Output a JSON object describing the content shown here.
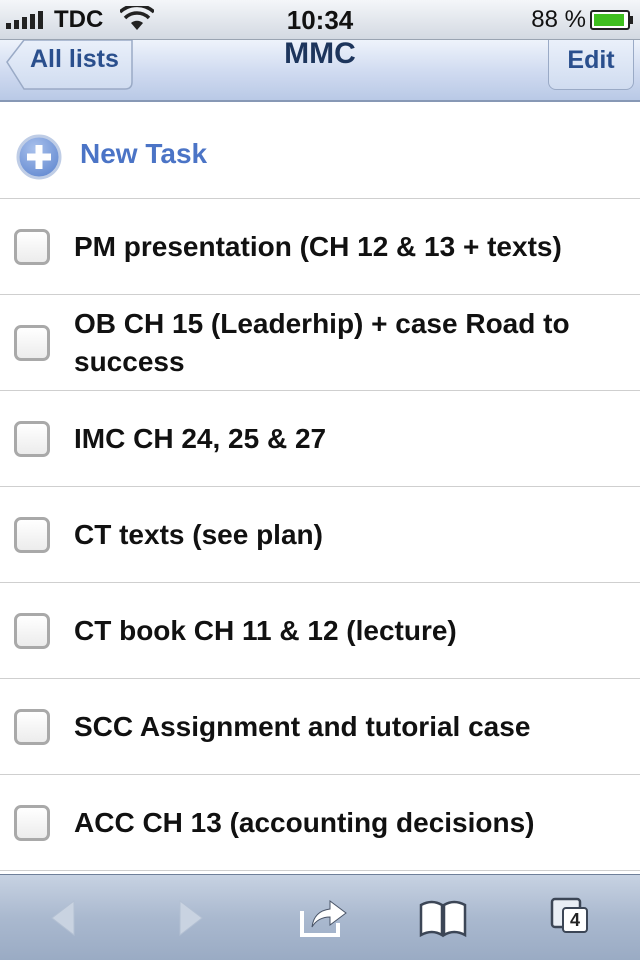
{
  "status_bar": {
    "carrier": "TDC",
    "time": "10:34",
    "battery": "88 %"
  },
  "nav": {
    "back_label": "All lists",
    "title": "MMC",
    "edit_label": "Edit"
  },
  "new_task_label": "New Task",
  "tasks": [
    {
      "text": "PM presentation (CH 12 & 13 + texts)",
      "checked": false
    },
    {
      "text": "OB CH 15 (Leaderhip) + case Road to success",
      "checked": false
    },
    {
      "text": "IMC CH 24, 25 & 27",
      "checked": false
    },
    {
      "text": "CT texts (see plan)",
      "checked": false
    },
    {
      "text": "CT book CH 11 & 12 (lecture)",
      "checked": false
    },
    {
      "text": "SCC Assignment and tutorial case",
      "checked": false
    },
    {
      "text": "ACC CH 13 (accounting decisions)",
      "checked": false
    }
  ],
  "toolbar": {
    "pages_count": "4",
    "icons": [
      "back-arrow-icon",
      "forward-arrow-icon",
      "share-icon",
      "bookmarks-icon",
      "pages-icon"
    ]
  },
  "colors": {
    "accent": "#4b74c6",
    "nav_text": "#2a4f8d",
    "battery": "#3fbf1f"
  }
}
